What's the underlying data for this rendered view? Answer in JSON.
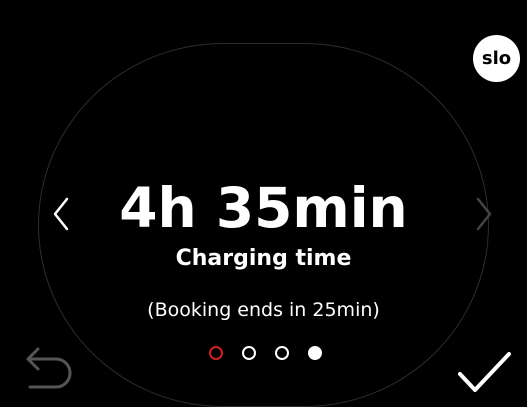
{
  "language": {
    "label": "slo"
  },
  "main": {
    "value": "4h 35min",
    "label": "Charging time",
    "note": "(Booking ends in 25min)"
  },
  "pager": {
    "total": 4,
    "current": 1,
    "selected": 4
  },
  "colors": {
    "background": "#000000",
    "text": "#ffffff",
    "pager_current": "#d02020",
    "disabled_arrow": "#444444",
    "back_icon": "#555555"
  },
  "icons": {
    "prev": "chevron-left-icon",
    "next": "chevron-right-icon",
    "back": "return-arrow-icon",
    "confirm": "checkmark-icon"
  }
}
